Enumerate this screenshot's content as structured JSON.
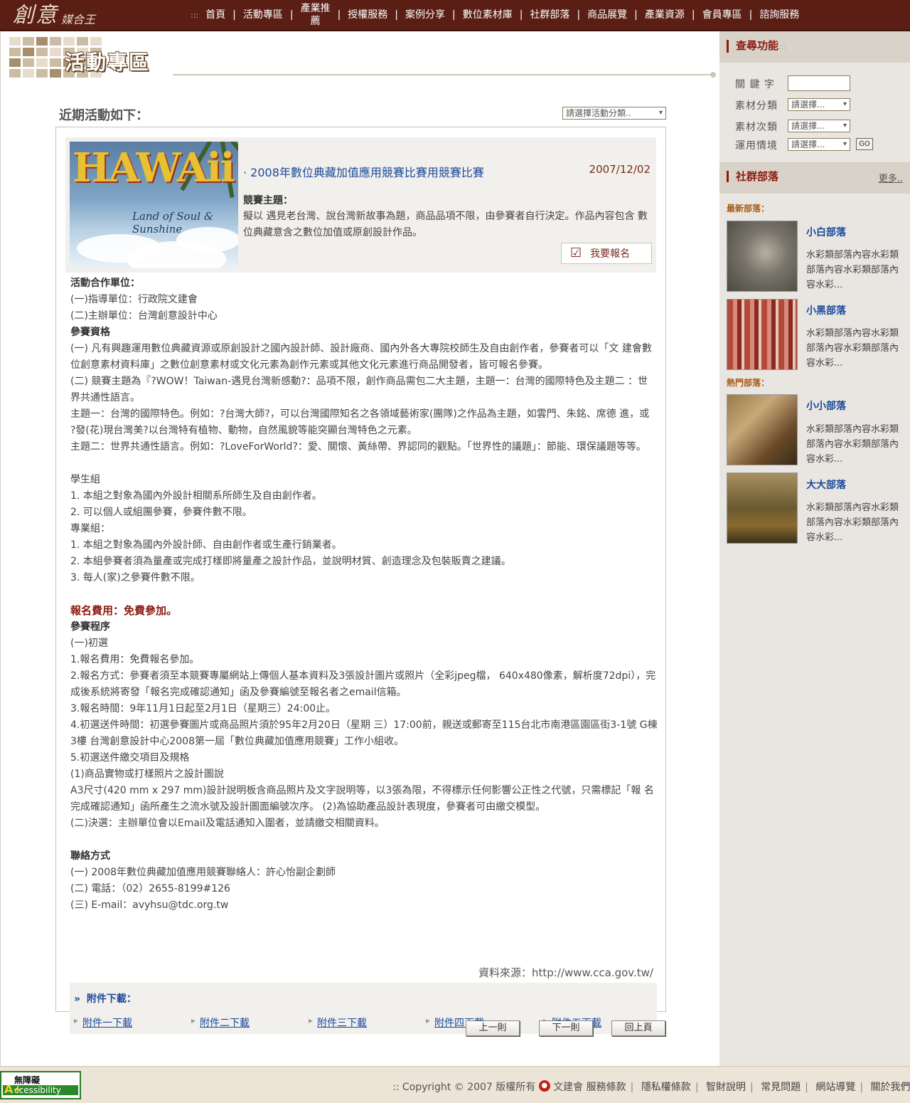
{
  "logo": {
    "main": "創意",
    "sub": "媒合王"
  },
  "nav": {
    "bullet": ":::",
    "items": [
      "首頁",
      "活動專區",
      "產業推薦",
      "授權服務",
      "案例分享",
      "數位素材庫",
      "社群部落",
      "商品展覽",
      "產業資源",
      "會員專區",
      "諮詢服務"
    ]
  },
  "banner": {
    "title": "活動專區"
  },
  "recent": {
    "title": "近期活動如下：",
    "category_placeholder": "請選擇活動分類.."
  },
  "event": {
    "title": "· 2008年數位典藏加值應用競賽比賽用競賽比賽",
    "date": "2007/12/02",
    "image_text": "HAWAii",
    "image_subtext": "Land of Soul & Sunshine",
    "theme_label": "競賽主題：",
    "theme_text": "擬以 遇見老台灣、說台灣新故事為題，商品品項不限，由參賽者自行決定。作品內容包含 數位典藏意含之數位加值或原創設計作品。",
    "register": "我要報名"
  },
  "body": {
    "coop_h": "活動合作單位：",
    "coop_1": "(一)指導單位：行政院文建會",
    "coop_2": "(二)主辦單位：台灣創意設計中心",
    "elig_h": "參賽資格",
    "elig_1": "(一) 凡有興趣運用數位典藏資源或原創設計之國內設計師、設計廠商、國內外各大專院校師生及自由創作者，參賽者可以「文 建會數位創意素材資料庫」之數位創意素材或文化元素為創作元素或其他文化元素進行商品開發者，皆可報名參賽。",
    "elig_2": "(二) 競賽主題為『?WOW！Taiwan-遇見台灣新感動?：品項不限，創作商品需包二大主題，主題一：台灣的國際特色及主題二 ：世界共通性語言。",
    "topic_1": "主題一：台灣的國際特色。例如：?台灣大師?，可以台灣國際知名之各領域藝術家(團隊)之作品為主題，如雲門、朱銘、席德 進，或 ?發(花)現台灣美?以台灣特有植物、動物，自然風貌等能突顯台灣特色之元素。",
    "topic_2": "主題二：世界共通性語言。例如：?LoveForWorld?：愛、關懷、黃絲帶、界認同的觀點。「世界性的議題」：節能、環保議題等等。",
    "student_h": "學生組",
    "student_1": "1. 本組之對象為國內外設計相關系所師生及自由創作者。",
    "student_2": "2. 可以個人或組團參賽，參賽件數不限。",
    "pro_h": "專業組：",
    "pro_1": "1. 本組之對象為國內外設計師、自由創作者或生產行銷業者。",
    "pro_2": "2. 本組參賽者須為量產或完成打樣即將量產之設計作品，並說明材質、創造理念及包裝販賣之建議。",
    "pro_3": "3. 每人(家)之參賽件數不限。",
    "fee": "報名費用：免費參加。",
    "proc_h": "參賽程序",
    "proc_1": "(一)初選",
    "proc_2": "1.報名費用：免費報名參加。",
    "proc_3": "2.報名方式：參賽者須至本競賽專屬網站上傳個人基本資料及3張設計圖片或照片（全彩jpeg檔， 640x480像素，解析度72dpi），完成後系統將寄發「報名完成確認通知」函及參賽編號至報名者之email信箱。",
    "proc_4": "3.報名時間：9年11月1日起至2月1日（星期三）24:00止。",
    "proc_5": "4.初選送件時間：初選參賽圖片或商品照片須於95年2月20日（星期 三）17:00前，親送或郵寄至115台北市南港區園區街3-1號 G棟3樓 台灣創意設計中心2008第一屆「數位典藏加值應用競賽」工作小組收。",
    "proc_6": "5.初選送件繳交項目及規格",
    "proc_7": "(1)商品實物或打樣照片之設計圖說",
    "proc_8": "A3尺寸(420 mm x 297 mm)設計說明板含商品照片及文字說明等，以3張為限，不得標示任何影響公正性之代號，只需標記「報 名完成確認通知」函所產生之流水號及設計圖面編號次序。 (2)為協助產品設計表現度，參賽者可由繳交模型。",
    "proc_9": "(二)決選：主辦單位會以Email及電話通知入圍者，並請繳交相關資料。",
    "contact_h": "聯絡方式",
    "contact_1": "(一) 2008年數位典藏加值應用競賽聯絡人：許心怡副企劃師",
    "contact_2": "(二) 電話：（02）2655-8199#126",
    "contact_3": "(三) E-mail：avyhsu@tdc.org.tw",
    "source": "資料來源：http://www.cca.gov.tw/"
  },
  "attachments": {
    "title": "附件下載：",
    "marker": "»",
    "items": [
      "附件一下載",
      "附件二下載",
      "附件三下載",
      "附件四下載",
      "附件五下載"
    ]
  },
  "pager": {
    "prev": "上一則",
    "next": "下一則",
    "back": "回上頁"
  },
  "side": {
    "search": {
      "title": "查尋功能",
      "dots": ":::",
      "keyword_label": "關 鍵 字",
      "cat_label": "素材分類",
      "subcat_label": "素材次類",
      "usage_label": "運用情境",
      "select_placeholder": "請選擇...",
      "go": "GO"
    },
    "tribes": {
      "title": "社群部落",
      "more": "更多..",
      "newest_label": "最新部落：",
      "hot_label": "熱門部落：",
      "items": [
        {
          "name": "小白部落",
          "desc": "水彩類部落內容水彩類部落內容水彩類部落內容水彩..."
        },
        {
          "name": "小黑部落",
          "desc": "水彩類部落內容水彩類部落內容水彩類部落內容水彩..."
        },
        {
          "name": "小小部落",
          "desc": "水彩類部落內容水彩類部落內容水彩類部落內容水彩..."
        },
        {
          "name": "大大部落",
          "desc": "水彩類部落內容水彩類部落內容水彩類部落內容水彩..."
        }
      ]
    }
  },
  "footer": {
    "a11y_1": "無障礙",
    "a11y_2": "ccessibility",
    "a11y_plus": "A+",
    "copyright": ":: Copyright © 2007 版權所有",
    "org": "文建會",
    "links": [
      "服務條款",
      "隱私權條款",
      "智財說明",
      "常見問題",
      "網站導覽",
      "關於我們"
    ]
  },
  "colors": {
    "nav_bg": "#5a1e14",
    "accent": "#8a1a10",
    "link": "#1a4a9c",
    "sidebar_bg": "#e9e6e2"
  }
}
